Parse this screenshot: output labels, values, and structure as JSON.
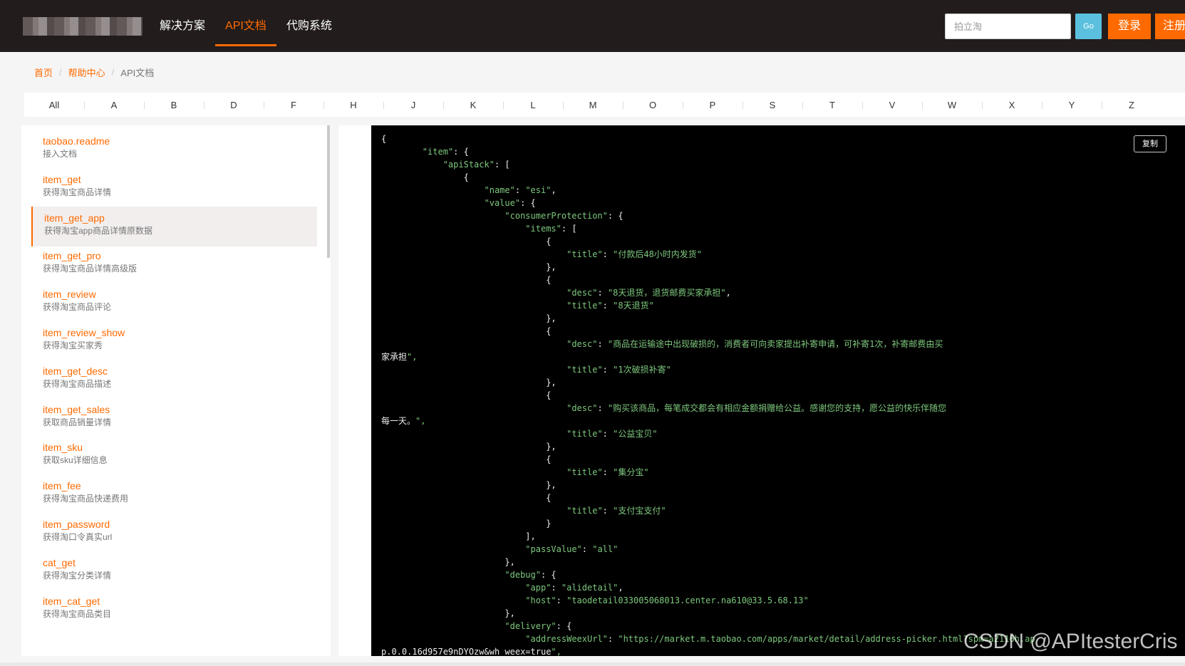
{
  "header": {
    "nav": [
      "解决方案",
      "API文档",
      "代购系统"
    ],
    "search_placeholder": "拍立淘",
    "go_label": "Go",
    "login_label": "登录",
    "register_label": "注册"
  },
  "breadcrumb": {
    "home": "首页",
    "help": "帮助中心",
    "current": "API文档",
    "separator": "/"
  },
  "alphabet": [
    "All",
    "A",
    "B",
    "D",
    "F",
    "H",
    "J",
    "K",
    "L",
    "M",
    "O",
    "P",
    "S",
    "T",
    "V",
    "W",
    "X",
    "Y",
    "Z"
  ],
  "sidebar": {
    "items": [
      {
        "name": "taobao.readme",
        "desc": "接入文档"
      },
      {
        "name": "item_get",
        "desc": "获得淘宝商品详情"
      },
      {
        "name": "item_get_app",
        "desc": "获得淘宝app商品详情原数据"
      },
      {
        "name": "item_get_pro",
        "desc": "获得淘宝商品详情高级版"
      },
      {
        "name": "item_review",
        "desc": "获得淘宝商品评论"
      },
      {
        "name": "item_review_show",
        "desc": "获得淘宝买家秀"
      },
      {
        "name": "item_get_desc",
        "desc": "获得淘宝商品描述"
      },
      {
        "name": "item_get_sales",
        "desc": "获取商品销量详情"
      },
      {
        "name": "item_sku",
        "desc": "获取sku详细信息"
      },
      {
        "name": "item_fee",
        "desc": "获得淘宝商品快递费用"
      },
      {
        "name": "item_password",
        "desc": "获得淘口令真实url"
      },
      {
        "name": "cat_get",
        "desc": "获得淘宝分类详情"
      },
      {
        "name": "item_cat_get",
        "desc": "获得淘宝商品类目"
      }
    ],
    "active_index": 2
  },
  "code": {
    "copy_label": "复制",
    "json_text": "{\n\t\t\"item\": {\n\t\t\t\"apiStack\": [\n\t\t\t\t{\n\t\t\t\t\t\"name\": \"esi\",\n\t\t\t\t\t\"value\": {\n\t\t\t\t\t\t\"consumerProtection\": {\n\t\t\t\t\t\t\t\"items\": [\n\t\t\t\t\t\t\t\t{\n\t\t\t\t\t\t\t\t\t\"title\": \"付款后48小时内发货\"\n\t\t\t\t\t\t\t\t},\n\t\t\t\t\t\t\t\t{\n\t\t\t\t\t\t\t\t\t\"desc\": \"8天退货，退货邮费买家承担\",\n\t\t\t\t\t\t\t\t\t\"title\": \"8天退货\"\n\t\t\t\t\t\t\t\t},\n\t\t\t\t\t\t\t\t{\n\t\t\t\t\t\t\t\t\t\"desc\": \"商品在运输途中出现破损的，消费者可向卖家提出补寄申请，可补寄1次，补寄邮费由买\n家承担\",\n\t\t\t\t\t\t\t\t\t\"title\": \"1次破损补寄\"\n\t\t\t\t\t\t\t\t},\n\t\t\t\t\t\t\t\t{\n\t\t\t\t\t\t\t\t\t\"desc\": \"购买该商品，每笔成交都会有相应金额捐赠给公益。感谢您的支持，愿公益的快乐伴随您\n每一天。\",\n\t\t\t\t\t\t\t\t\t\"title\": \"公益宝贝\"\n\t\t\t\t\t\t\t\t},\n\t\t\t\t\t\t\t\t{\n\t\t\t\t\t\t\t\t\t\"title\": \"集分宝\"\n\t\t\t\t\t\t\t\t},\n\t\t\t\t\t\t\t\t{\n\t\t\t\t\t\t\t\t\t\"title\": \"支付宝支付\"\n\t\t\t\t\t\t\t\t}\n\t\t\t\t\t\t\t],\n\t\t\t\t\t\t\t\"passValue\": \"all\"\n\t\t\t\t\t\t},\n\t\t\t\t\t\t\"debug\": {\n\t\t\t\t\t\t\t\"app\": \"alidetail\",\n\t\t\t\t\t\t\t\"host\": \"taodetail033005068013.center.na610@33.5.68.13\"\n\t\t\t\t\t\t},\n\t\t\t\t\t\t\"delivery\": {\n\t\t\t\t\t\t\t\"addressWeexUrl\": \"https://market.m.taobao.com/apps/market/detail/address-picker.html?spm=a2116h.ap\np.0.0.16d957e9nDYOzw&wh_weex=true\","
  },
  "watermark": "CSDN @APItesterCris",
  "colors": {
    "accent": "#ff6a00",
    "key": "#7ec87e",
    "header_bg": "#221c1c"
  }
}
